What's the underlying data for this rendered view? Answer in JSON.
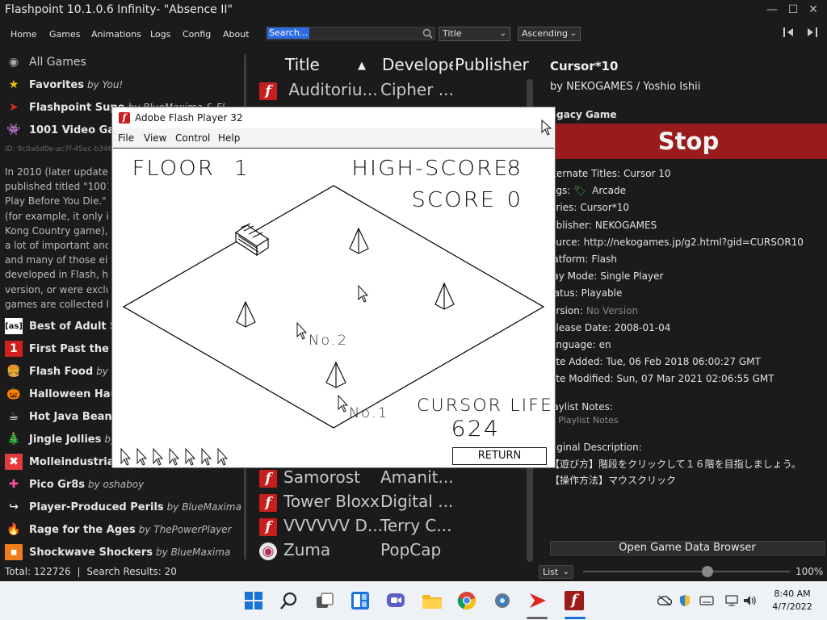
{
  "app": {
    "title": "Flashpoint 10.1.0.6 Infinity- \"Absence II\""
  },
  "menu": [
    "Home",
    "Games",
    "Animations",
    "Logs",
    "Config",
    "About"
  ],
  "search": {
    "placeholder": "Search..."
  },
  "sort_by": {
    "value": "Title"
  },
  "sort_order": {
    "value": "Ascending"
  },
  "sidebar": {
    "all_games": "All Games",
    "playlists_top": [
      {
        "name": "Favorites",
        "author": "by You!",
        "icon": "star-icon",
        "color": "#f2c21b"
      },
      {
        "name": "Flashpoint Supe",
        "author": "by BlueMaxima & Fl",
        "icon": "flashpoint-logo-icon",
        "color": "#d32d2d"
      },
      {
        "name": "1001 Video Gar",
        "author": "",
        "icon": "invader-icon",
        "color": "#ffffff"
      }
    ],
    "playlist_id": "ID: 9c0a6d0e-ac7f-45ec-b346",
    "description": [
      "In 2010 (later updated",
      "published titled \"1001",
      "Play Before You Die.\" W",
      "(for example, it only in",
      "Kong Country game), it",
      "a lot of important and",
      "and many of those eith",
      "developed in Flash, had",
      "version, or were exclus",
      "games are collected he"
    ],
    "playlists": [
      {
        "name": "Best of Adult Sw",
        "author": "",
        "icon": "as-icon",
        "color": "#111111"
      },
      {
        "name": "First Past the Po",
        "author": "",
        "icon": "number-one-icon",
        "color": "#d22020"
      },
      {
        "name": "Flash Food",
        "author": "by Th",
        "icon": "burger-icon",
        "color": "#e2a43a"
      },
      {
        "name": "Halloween Hau",
        "author": "",
        "icon": "pumpkin-icon",
        "color": "#f07a16"
      },
      {
        "name": "Hot Java Beans",
        "author": "",
        "icon": "coffee-cup-icon",
        "color": "#ffffff"
      },
      {
        "name": "Jingle Jollies",
        "author": "by",
        "icon": "christmas-tree-icon",
        "color": "#2aa84a"
      },
      {
        "name": "Molleindustria'",
        "author": "",
        "icon": "molleindustria-icon",
        "color": "#e23b3b"
      },
      {
        "name": "Pico Gr8s",
        "author": "by oshaboy",
        "icon": "pico-icon",
        "color": "#ff4fa3"
      },
      {
        "name": "Player-Produced Perils",
        "author": "by BlueMaxima",
        "icon": "share-icon",
        "color": "#ffffff"
      },
      {
        "name": "Rage for the Ages",
        "author": "by ThePowerPlayer",
        "icon": "fire-icon",
        "color": "#f06a1a"
      },
      {
        "name": "Shockwave Shockers",
        "author": "by BlueMaxima",
        "icon": "shockwave-icon",
        "color": "#f07c1c"
      }
    ]
  },
  "columns": {
    "title": "Title",
    "developer": "Develope",
    "publisher": "Publisher"
  },
  "games_top": [
    {
      "title": "Auditoriu...",
      "developer": "Cipher ..."
    }
  ],
  "games": [
    {
      "title": "Samorost",
      "developer": "Amanit..."
    },
    {
      "title": "Tower Bloxx",
      "developer": "Digital ..."
    },
    {
      "title": "VVVVVV D...",
      "developer": "Terry C..."
    },
    {
      "title": "Zuma",
      "developer": "PopCap"
    }
  ],
  "details": {
    "title": "Cursor*10",
    "by": "by NEKOGAMES / Yoshio Ishii",
    "legacy": "egacy Game",
    "stop_label": "Stop",
    "fields": [
      {
        "label": "lternate Titles:",
        "value": "Cursor 10"
      },
      {
        "label": "ags:",
        "value": "Arcade"
      },
      {
        "label": "eries:",
        "value": "Cursor*10"
      },
      {
        "label": "ublisher:",
        "value": "NEKOGAMES"
      },
      {
        "label": "ource:",
        "value": "http://nekogames.jp/g2.html?gid=CURSOR10"
      },
      {
        "label": "latform:",
        "value": "Flash"
      },
      {
        "label": "lay Mode:",
        "value": "Single Player"
      },
      {
        "label": "tatus:",
        "value": "Playable"
      },
      {
        "label": "ersion:",
        "value": "No Version"
      },
      {
        "label": "elease Date:",
        "value": "2008-01-04"
      },
      {
        "label": "anguage:",
        "value": "en"
      },
      {
        "label": "ate Added:",
        "value": "Tue, 06 Feb 2018 06:00:27 GMT"
      },
      {
        "label": "ate Modified:",
        "value": "Sun, 07 Mar 2021 02:06:55 GMT"
      }
    ],
    "playlist_notes_label": "laylist Notes:",
    "playlist_notes_value": "o Playlist Notes",
    "orig_desc_label": "riginal Description:",
    "orig_desc_line1": "【遊び方】階段をクリックして１６階を目指しましょう。",
    "orig_desc_line2": "【操作方法】マウスクリック",
    "open_browser": "Open Game Data Browser"
  },
  "statusbar": {
    "total": "Total: 122726",
    "results": "Search Results: 20",
    "view": "List",
    "zoom": "100%",
    "zoom_level": 0.6
  },
  "flash": {
    "title": "Adobe Flash Player 32",
    "menu": [
      "File",
      "View",
      "Control",
      "Help"
    ],
    "game": {
      "floor_label": "FLOOR",
      "floor_value": "1",
      "highscore_label": "HIGH-SCORE",
      "highscore_value": "8",
      "score_label": "SCORE",
      "score_value": "0",
      "no2": "No.2",
      "no1": "No.1",
      "cursor_life_label": "CURSOR LIFE",
      "cursor_life_value": "624",
      "return_label": "RETURN"
    }
  },
  "clock": {
    "time": "8:40 AM",
    "date": "4/7/2022"
  }
}
